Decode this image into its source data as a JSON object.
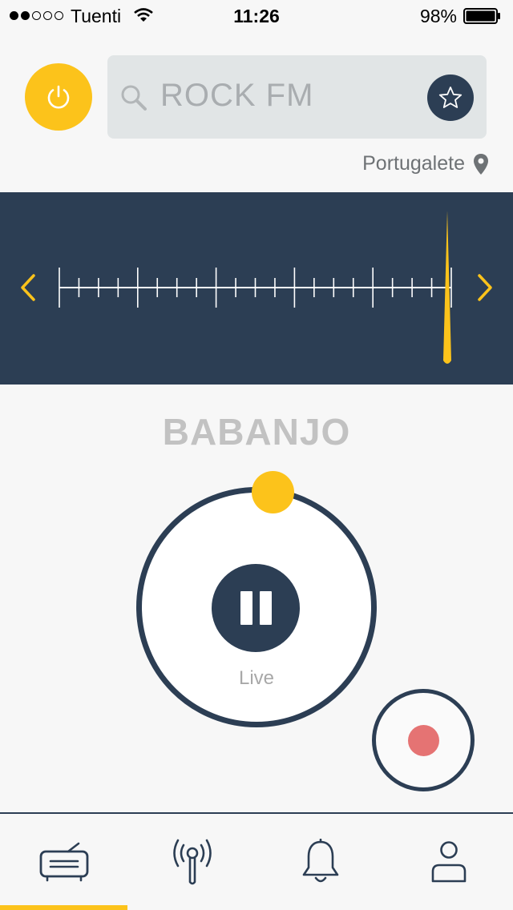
{
  "status_bar": {
    "carrier": "Tuenti",
    "time": "11:26",
    "battery_percent": "98%",
    "signal_bars_filled": 2,
    "signal_bars_total": 5
  },
  "search": {
    "value": "ROCK FM"
  },
  "location": {
    "label": "Portugalete"
  },
  "tuner": {
    "needle_position": 0.99
  },
  "player": {
    "station_name": "BABANJO",
    "state_label": "Live",
    "progress": 0.0
  },
  "tabs": [
    {
      "name": "radio",
      "icon": "radio-icon",
      "active": true
    },
    {
      "name": "broadcast",
      "icon": "antenna-icon",
      "active": false
    },
    {
      "name": "alerts",
      "icon": "bell-icon",
      "active": false
    },
    {
      "name": "profile",
      "icon": "user-icon",
      "active": false
    }
  ],
  "colors": {
    "accent": "#fcc31b",
    "primary": "#2c3e54",
    "record": "#e57373",
    "background": "#f7f7f7"
  }
}
